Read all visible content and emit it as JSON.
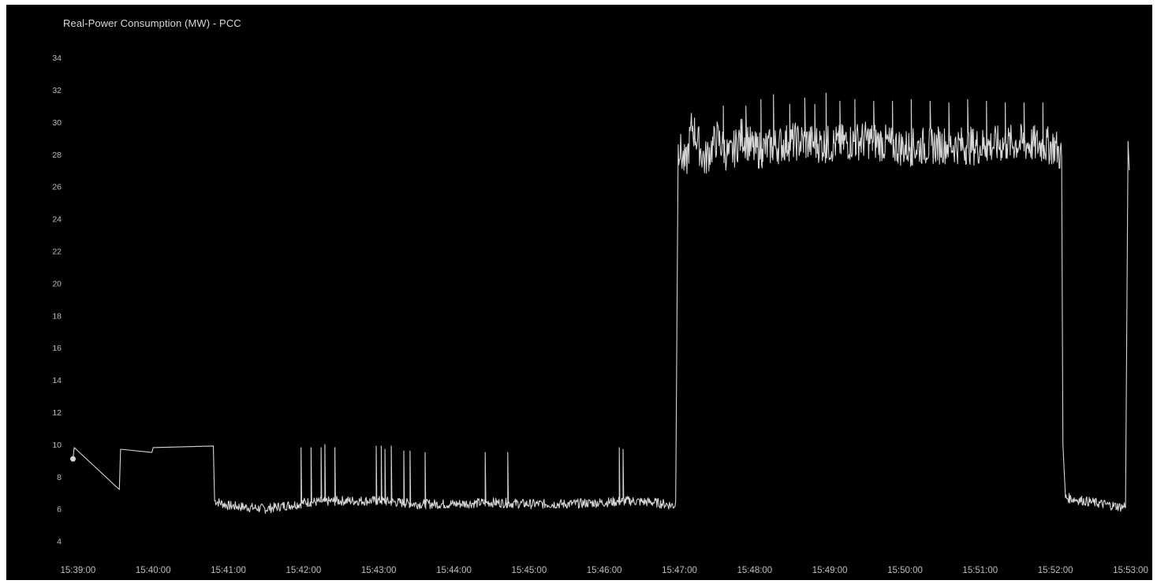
{
  "chart_data": {
    "type": "line",
    "title": "Real-Power Consumption (MW) - PCC",
    "xlabel": "",
    "ylabel": "",
    "ylim": [
      3,
      35
    ],
    "y_ticks": [
      4,
      6,
      8,
      10,
      12,
      14,
      16,
      18,
      20,
      22,
      24,
      26,
      28,
      30,
      32,
      34
    ],
    "x_ticks": [
      "15:39:00",
      "15:40:00",
      "15:41:00",
      "15:42:00",
      "15:43:00",
      "15:44:00",
      "15:45:00",
      "15:46:00",
      "15:47:00",
      "15:48:00",
      "15:49:00",
      "15:50:00",
      "15:51:00",
      "15:52:00",
      "15:53:00"
    ],
    "xlim": [
      "15:38:50",
      "15:53:06"
    ],
    "grid": false,
    "legend": "none",
    "colors": {
      "background": "#000000",
      "line": "#d6d6d6",
      "text": "#bdbdbd"
    },
    "series": [
      {
        "points": [
          [
            "15:38:56",
            9.1
          ],
          [
            "15:38:57",
            9.8
          ],
          [
            "15:39:33",
            7.2
          ],
          [
            "15:39:34",
            9.7
          ],
          [
            "15:39:59",
            9.5
          ],
          [
            "15:40:00",
            9.8
          ],
          [
            "15:40:48",
            9.9
          ],
          [
            "15:40:49",
            6.5
          ],
          [
            "15:41:00",
            6.2
          ],
          [
            "15:41:30",
            6.0
          ],
          [
            "15:41:45",
            6.2
          ],
          [
            "15:41:57",
            6.3
          ],
          [
            "15:42:00",
            6.4
          ],
          [
            "15:42:30",
            6.5
          ],
          [
            "15:43:00",
            6.5
          ],
          [
            "15:43:30",
            6.3
          ],
          [
            "15:44:00",
            6.3
          ],
          [
            "15:44:30",
            6.4
          ],
          [
            "15:45:00",
            6.3
          ],
          [
            "15:45:30",
            6.3
          ],
          [
            "15:46:00",
            6.4
          ],
          [
            "15:46:20",
            6.5
          ],
          [
            "15:46:40",
            6.4
          ],
          [
            "15:46:56",
            6.2
          ],
          [
            "15:46:57",
            6.4
          ],
          [
            "15:46:59",
            28.6
          ],
          [
            "15:47:05",
            27.2
          ],
          [
            "15:47:10",
            29.8
          ],
          [
            "15:47:20",
            27.6
          ],
          [
            "15:47:30",
            29.0
          ],
          [
            "15:47:40",
            27.8
          ],
          [
            "15:47:50",
            29.2
          ],
          [
            "15:48:00",
            28.2
          ],
          [
            "15:48:30",
            28.8
          ],
          [
            "15:49:00",
            28.6
          ],
          [
            "15:49:30",
            28.9
          ],
          [
            "15:50:00",
            28.4
          ],
          [
            "15:50:30",
            28.6
          ],
          [
            "15:51:00",
            28.5
          ],
          [
            "15:51:30",
            28.7
          ],
          [
            "15:52:00",
            28.5
          ],
          [
            "15:52:05",
            27.8
          ],
          [
            "15:52:06",
            10.0
          ],
          [
            "15:52:08",
            6.7
          ],
          [
            "15:52:30",
            6.4
          ],
          [
            "15:52:54",
            6.1
          ],
          [
            "15:52:56",
            6.3
          ],
          [
            "15:52:58",
            28.8
          ],
          [
            "15:52:59",
            27.0
          ]
        ],
        "spikes_low_phase": [
          {
            "t": "15:41:58",
            "peak": 9.8
          },
          {
            "t": "15:42:06",
            "peak": 9.8
          },
          {
            "t": "15:42:14",
            "peak": 9.8
          },
          {
            "t": "15:42:17",
            "peak": 10.0
          },
          {
            "t": "15:42:25",
            "peak": 9.8
          },
          {
            "t": "15:42:58",
            "peak": 9.9
          },
          {
            "t": "15:43:02",
            "peak": 9.9
          },
          {
            "t": "15:43:05",
            "peak": 9.7
          },
          {
            "t": "15:43:10",
            "peak": 9.9
          },
          {
            "t": "15:43:20",
            "peak": 9.6
          },
          {
            "t": "15:43:25",
            "peak": 9.6
          },
          {
            "t": "15:43:37",
            "peak": 9.5
          },
          {
            "t": "15:44:25",
            "peak": 9.5
          },
          {
            "t": "15:44:43",
            "peak": 9.5
          },
          {
            "t": "15:46:12",
            "peak": 9.8
          },
          {
            "t": "15:46:15",
            "peak": 9.7
          }
        ],
        "spikes_high_phase": [
          {
            "t": "15:47:35",
            "peak": 31.0
          },
          {
            "t": "15:47:53",
            "peak": 31.0
          },
          {
            "t": "15:48:05",
            "peak": 31.4
          },
          {
            "t": "15:48:15",
            "peak": 31.7
          },
          {
            "t": "15:48:28",
            "peak": 31.1
          },
          {
            "t": "15:48:40",
            "peak": 31.5
          },
          {
            "t": "15:48:48",
            "peak": 31.1
          },
          {
            "t": "15:48:57",
            "peak": 31.8
          },
          {
            "t": "15:49:08",
            "peak": 31.3
          },
          {
            "t": "15:49:20",
            "peak": 31.4
          },
          {
            "t": "15:49:35",
            "peak": 31.3
          },
          {
            "t": "15:49:50",
            "peak": 31.3
          },
          {
            "t": "15:50:05",
            "peak": 31.4
          },
          {
            "t": "15:50:20",
            "peak": 31.3
          },
          {
            "t": "15:50:35",
            "peak": 31.2
          },
          {
            "t": "15:50:50",
            "peak": 31.4
          },
          {
            "t": "15:51:05",
            "peak": 31.3
          },
          {
            "t": "15:51:20",
            "peak": 31.2
          },
          {
            "t": "15:51:35",
            "peak": 31.2
          },
          {
            "t": "15:51:50",
            "peak": 31.2
          }
        ],
        "noise_MW": {
          "low_phase": 0.3,
          "high_phase": 1.2
        }
      }
    ]
  }
}
